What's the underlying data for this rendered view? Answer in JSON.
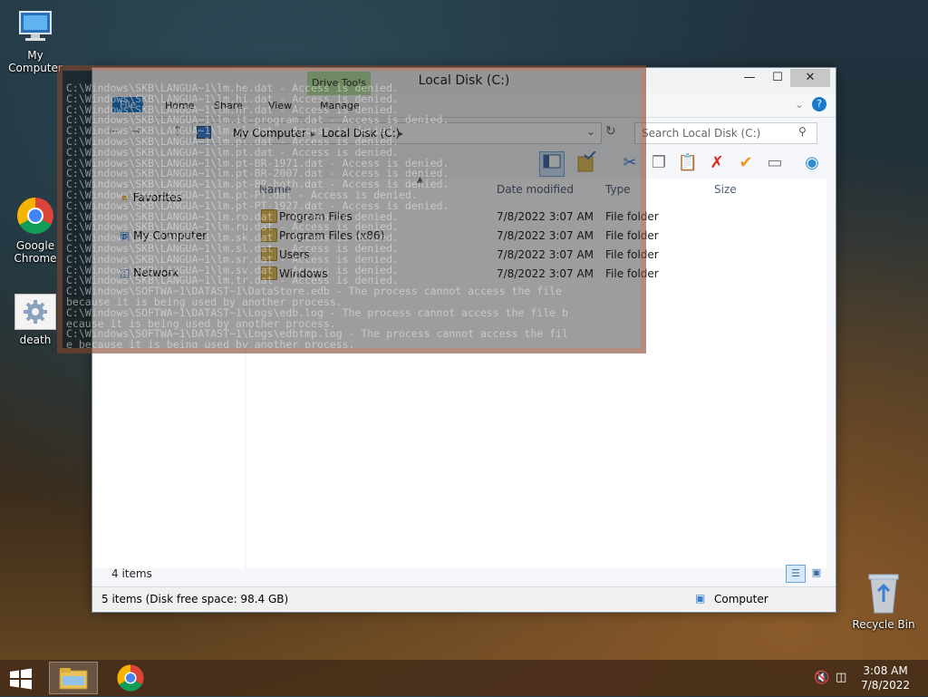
{
  "desktop": {
    "icons": [
      {
        "label": "My Computer",
        "icon": "computer-icon"
      },
      {
        "label": "Google Chrome",
        "icon": "chrome-icon"
      },
      {
        "label": "death",
        "icon": "settings-file-icon"
      },
      {
        "label": "Recycle Bin",
        "icon": "recycle-bin-icon"
      }
    ]
  },
  "console": {
    "lines": [
      "C:\\Windows\\SKB\\LANGUA~1\\lm.he.dat - Access is denied.",
      "C:\\Windows\\SKB\\LANGUA~1\\lm.hi.dat - Access is denied.",
      "C:\\Windows\\SKB\\LANGUA~1\\lm.hr.dat - Access is denied.",
      "C:\\Windows\\SKB\\LANGUA~1\\lm.it-program.dat - Access is denied.",
      "C:\\Windows\\SKB\\LANGUA~1\\lm.nl.dat - Access is denied.",
      "C:\\Windows\\SKB\\LANGUA~1\\lm.pl.dat - Access is denied.",
      "C:\\Windows\\SKB\\LANGUA~1\\lm.pt.dat - Access is denied.",
      "C:\\Windows\\SKB\\LANGUA~1\\lm.pt-BR-1971.dat - Access is denied.",
      "C:\\Windows\\SKB\\LANGUA~1\\lm.pt-BR-2007.dat - Access is denied.",
      "C:\\Windows\\SKB\\LANGUA~1\\lm.pt-BR-both.dat - Access is denied.",
      "C:\\Windows\\SKB\\LANGUA~1\\lm.pt-PT.dat - Access is denied.",
      "C:\\Windows\\SKB\\LANGUA~1\\lm.pt-PT-1927.dat - Access is denied.",
      "C:\\Windows\\SKB\\LANGUA~1\\lm.ro.dat - Access is denied.",
      "C:\\Windows\\SKB\\LANGUA~1\\lm.ru.dat - Access is denied.",
      "C:\\Windows\\SKB\\LANGUA~1\\lm.sk.dat - Access is denied.",
      "C:\\Windows\\SKB\\LANGUA~1\\lm.sl.dat - Access is denied.",
      "C:\\Windows\\SKB\\LANGUA~1\\lm.sr.dat - Access is denied.",
      "C:\\Windows\\SKB\\LANGUA~1\\lm.sv.dat - Access is denied.",
      "C:\\Windows\\SKB\\LANGUA~1\\lm.tr.dat - Access is denied.",
      "C:\\Windows\\SOFTWA~1\\DATAST~1\\DataStore.edb - The process cannot access the file",
      "because it is being used by another process.",
      "C:\\Windows\\SOFTWA~1\\DATAST~1\\Logs\\edb.log - The process cannot access the file b",
      "ecause it is being used by another process.",
      "C:\\Windows\\SOFTWA~1\\DATAST~1\\Logs\\edbtmp.log - The process cannot access the fil",
      "e because it is being used by another process."
    ]
  },
  "explorer": {
    "title": "Local Disk (C:)",
    "ribbon": {
      "context_tab": "Drive Tools",
      "tabs": [
        "File",
        "Home",
        "Share",
        "View",
        "Manage"
      ]
    },
    "address": {
      "crumbs": [
        "My Computer",
        "Local Disk (C:)"
      ]
    },
    "search_placeholder": "Search Local Disk (C:)",
    "nav": [
      {
        "label": "Favorites",
        "icon": "star-icon"
      },
      {
        "label": "My Computer",
        "icon": "computer-icon"
      },
      {
        "label": "Network",
        "icon": "network-icon"
      }
    ],
    "columns": [
      "Name",
      "Date modified",
      "Type",
      "Size"
    ],
    "rows": [
      {
        "name": "Program Files",
        "date": "7/8/2022 3:07 AM",
        "type": "File folder"
      },
      {
        "name": "Program Files (x86)",
        "date": "7/8/2022 3:07 AM",
        "type": "File folder"
      },
      {
        "name": "Users",
        "date": "7/8/2022 3:07 AM",
        "type": "File folder"
      },
      {
        "name": "Windows",
        "date": "7/8/2022 3:07 AM",
        "type": "File folder"
      }
    ],
    "item_count": "4 items",
    "status_left": "5 items (Disk free space: 98.4 GB)",
    "status_right": "Computer"
  },
  "taskbar": {
    "time": "3:08 AM",
    "date": "7/8/2022"
  },
  "colors": {
    "accent": "#3399ff",
    "context_tab": "#b4e19f",
    "delete_red": "#d9261c",
    "check_orange": "#f0962b"
  }
}
